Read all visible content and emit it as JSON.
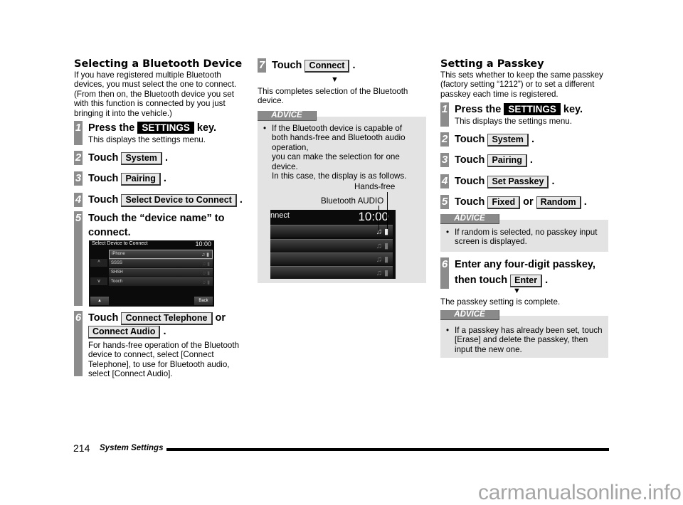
{
  "left": {
    "title": "Selecting a Bluetooth Device",
    "intro": "If you have registered multiple Bluetooth devices, you must select the one to connect. (From then on, the Bluetooth device you set with this function is connected by you just bringing it into the vehicle.)",
    "steps": [
      {
        "num": "1",
        "pre": "Press the",
        "key": "SETTINGS",
        "post": "key.",
        "sub": "This displays the settings menu."
      },
      {
        "num": "2",
        "pre": "Touch",
        "button": "System",
        "post": "."
      },
      {
        "num": "3",
        "pre": "Touch",
        "button": "Pairing",
        "post": "."
      },
      {
        "num": "4",
        "pre": "Touch",
        "button": "Select Device to Connect",
        "post": "."
      },
      {
        "num": "5",
        "line1": "Touch the “device name” to",
        "line2": "connect."
      },
      {
        "num": "6",
        "pre": "Touch",
        "button": "Connect Telephone",
        "mid": "or",
        "button2": "Connect Audio",
        "post": ".",
        "sub": "For hands-free operation of the Bluetooth device to connect, select [Connect Telephone], to use for Bluetooth audio, select [Connect Audio]."
      }
    ],
    "screen": {
      "title": "Select Device to Connect",
      "time": "10:00",
      "devices": [
        "iPhone",
        "SSSS",
        "SHSH",
        "Tooch"
      ],
      "up_icon": "^",
      "down_icon": "v",
      "eject_icon": "▲",
      "back_label": "Back",
      "music_icon": "♫",
      "phone_icon": "▮"
    }
  },
  "middle": {
    "step7": {
      "num": "7",
      "pre": "Touch",
      "button": "Connect",
      "post": "."
    },
    "arrow": "▼",
    "result": "This completes selection of the Bluetooth device.",
    "advice": {
      "label": "ADVICE",
      "bullet": "•",
      "text_lines": [
        "If the Bluetooth device is capable of",
        "both hands-free and Bluetooth audio",
        "operation,",
        "you can make the selection for one",
        "device.",
        "In this case, the display is as follows."
      ],
      "callout_handsfree": "Hands-free",
      "callout_audio": "Bluetooth AUDIO",
      "screen_title": "nnect",
      "screen_time": "10:00",
      "music_icon": "♫",
      "phone_icon": "▮"
    }
  },
  "right": {
    "title": "Setting a Passkey",
    "intro": "This sets whether to keep the same passkey (factory setting “1212”) or to set a different passkey each time is registered.",
    "steps": [
      {
        "num": "1",
        "pre": "Press the",
        "key": "SETTINGS",
        "post": "key.",
        "sub": "This displays the settings menu."
      },
      {
        "num": "2",
        "pre": "Touch",
        "button": "System",
        "post": "."
      },
      {
        "num": "3",
        "pre": "Touch",
        "button": "Pairing",
        "post": "."
      },
      {
        "num": "4",
        "pre": "Touch",
        "button": "Set Passkey",
        "post": "."
      },
      {
        "num": "5",
        "pre": "Touch",
        "button": "Fixed",
        "mid": "or",
        "button2": "Random",
        "post": "."
      },
      {
        "num": "6",
        "line1": "Enter any four-digit passkey,",
        "pre2": "then touch",
        "button": "Enter",
        "post": "."
      }
    ],
    "advice1": {
      "label": "ADVICE",
      "bullet": "•",
      "text": "If random is selected, no passkey input screen is displayed."
    },
    "arrow": "▼",
    "result": "The passkey setting is complete.",
    "advice2": {
      "label": "ADVICE",
      "bullet": "•",
      "text": "If a passkey has already been set, touch [Erase] and delete the passkey, then input the new one."
    }
  },
  "footer": {
    "page_number": "214",
    "section": "System Settings"
  },
  "watermark": "carmanualsonline.info"
}
